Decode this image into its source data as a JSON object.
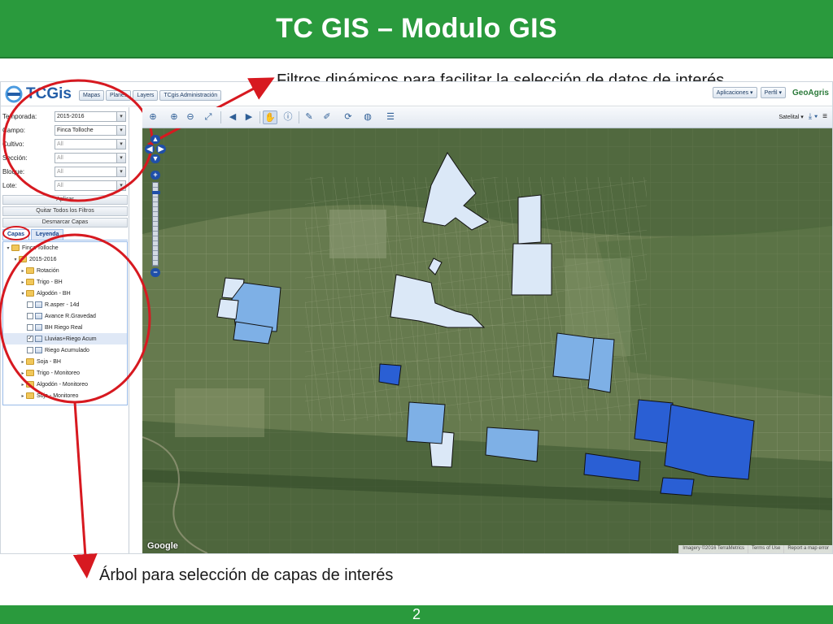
{
  "slide": {
    "title": "TC GIS – Modulo GIS",
    "callout_filters": "Filtros dinámicos para facilitar la selección de datos de interés",
    "callout_tree": "Árbol para selección de capas de interés",
    "page_number": "2"
  },
  "colors": {
    "title_green": "#2a9a3d",
    "annotation_red": "#d71920",
    "field_light": "#dbe8f7",
    "field_mid": "#7eb0e6",
    "field_dark": "#2a5fd4"
  },
  "app": {
    "logo_text": "TCGis",
    "nav": [
      "Mapas",
      "Planes",
      "Layers",
      "TCgis Administración"
    ],
    "header_right": {
      "aplicaciones": "Aplicaciones",
      "perfil": "Perfil",
      "brand": "GeoAgris"
    },
    "filters": [
      {
        "label": "Temporada:",
        "value": "2015-2016",
        "dim": false
      },
      {
        "label": "Campo:",
        "value": "Finca Tolloche",
        "dim": false
      },
      {
        "label": "Cultivo:",
        "value": "All",
        "dim": true
      },
      {
        "label": "Sección:",
        "value": "All",
        "dim": true
      },
      {
        "label": "Bloque:",
        "value": "All",
        "dim": true
      },
      {
        "label": "Lote:",
        "value": "All",
        "dim": true
      }
    ],
    "buttons": {
      "aplicar": "Aplicar",
      "quitar": "Quitar Todos los Filtros",
      "desmarcar": "Desmarcar Capas"
    },
    "tabs": {
      "capas": "Capas",
      "leyenda": "Leyenda"
    },
    "tree": [
      {
        "label": "Finca Tolloche",
        "indent": 0,
        "type": "folder",
        "toggle": "▾"
      },
      {
        "label": "2015-2016",
        "indent": 1,
        "type": "folder",
        "toggle": "▾"
      },
      {
        "label": "Rotación",
        "indent": 2,
        "type": "folder",
        "toggle": "▸"
      },
      {
        "label": "Trigo - BH",
        "indent": 2,
        "type": "folder",
        "toggle": "▸"
      },
      {
        "label": "Algodón - BH",
        "indent": 2,
        "type": "folder",
        "toggle": "▾"
      },
      {
        "label": "R.asper - 14d",
        "indent": 3,
        "type": "layer",
        "checked": false
      },
      {
        "label": "Avance R.Gravedad",
        "indent": 3,
        "type": "layer",
        "checked": false
      },
      {
        "label": "BH Riego Real",
        "indent": 3,
        "type": "layer",
        "checked": false
      },
      {
        "label": "Lluvias+Riego Acum",
        "indent": 3,
        "type": "layer",
        "checked": true,
        "selected": true
      },
      {
        "label": "Riego Acumulado",
        "indent": 3,
        "type": "layer",
        "checked": false
      },
      {
        "label": "Soja - BH",
        "indent": 2,
        "type": "folder",
        "toggle": "▸"
      },
      {
        "label": "Trigo - Monitoreo",
        "indent": 2,
        "type": "folder",
        "toggle": "▸"
      },
      {
        "label": "Algodón - Monitoreo",
        "indent": 2,
        "type": "folder",
        "toggle": "▸"
      },
      {
        "label": "Soja - Monitoreo",
        "indent": 2,
        "type": "folder",
        "toggle": "▸"
      }
    ],
    "map": {
      "toolbar_icons": [
        "zoom-extent-icon",
        "zoom-in-icon",
        "zoom-out-icon",
        "zoom-box-icon",
        "prev-extent-icon",
        "next-extent-icon",
        "pan-hand-icon",
        "info-icon",
        "measure-icon",
        "draw-icon",
        "refresh-icon",
        "globe-icon",
        "layers-icon"
      ],
      "basemap": "Satelital",
      "google": "Google",
      "attribution": [
        "Imagery ©2016 TerraMetrics",
        "Terms of Use",
        "Report a map error"
      ]
    }
  }
}
